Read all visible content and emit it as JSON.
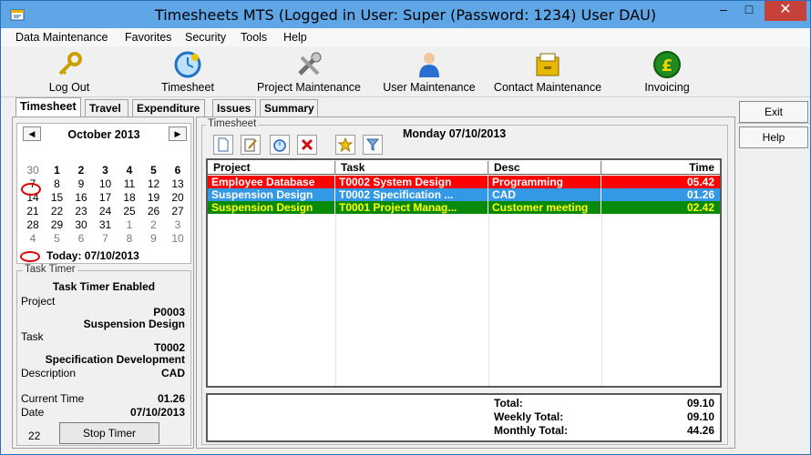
{
  "window": {
    "title": "Timesheets MTS (Logged in User: Super (Password: 1234) User DAU)"
  },
  "menu": [
    "Data Maintenance",
    "Favorites",
    "Security",
    "Tools",
    "Help"
  ],
  "toolbar": [
    {
      "label": "Log Out",
      "icon": "key-icon"
    },
    {
      "label": "Timesheet",
      "icon": "clock-icon"
    },
    {
      "label": "Project Maintenance",
      "icon": "tools-icon"
    },
    {
      "label": "User Maintenance",
      "icon": "user-icon"
    },
    {
      "label": "Contact Maintenance",
      "icon": "drawer-icon"
    },
    {
      "label": "Invoicing",
      "icon": "pound-coin-icon"
    }
  ],
  "tabs": [
    "Timesheet",
    "Travel",
    "Expenditure",
    "Issues",
    "Summary"
  ],
  "calendar": {
    "month": "October 2013",
    "weeks": [
      [
        "30",
        "1",
        "2",
        "3",
        "4",
        "5",
        "6"
      ],
      [
        "7",
        "8",
        "9",
        "10",
        "11",
        "12",
        "13"
      ],
      [
        "14",
        "15",
        "16",
        "17",
        "18",
        "19",
        "20"
      ],
      [
        "21",
        "22",
        "23",
        "24",
        "25",
        "26",
        "27"
      ],
      [
        "28",
        "29",
        "30",
        "31",
        "1",
        "2",
        "3"
      ],
      [
        "4",
        "5",
        "6",
        "7",
        "8",
        "9",
        "10"
      ]
    ],
    "today_text": "Today: 07/10/2013"
  },
  "timer": {
    "legend": "Task Timer",
    "status": "Task Timer Enabled",
    "project_label": "Project",
    "project_code": "P0003",
    "project_name": "Suspension Design",
    "task_label": "Task",
    "task_code": "T0002",
    "task_name": "Specification Development",
    "desc_label": "Description",
    "desc_value": "CAD",
    "current_time_label": "Current Time",
    "current_time_value": "01.26",
    "date_label": "Date",
    "date_value": "07/10/2013",
    "counter": "22",
    "stop_button": "Stop Timer"
  },
  "timesheet": {
    "legend": "Timesheet",
    "date": "Monday 07/10/2013",
    "columns": [
      "Project",
      "Task",
      "Desc",
      "Time"
    ],
    "rows": [
      {
        "project": "Employee Database",
        "task": "T0002 System Design",
        "desc": "Programming",
        "time": "05.42",
        "bg": "#ff0000",
        "fg": "#ffffff"
      },
      {
        "project": "Suspension Design",
        "task": "T0002 Specification ...",
        "desc": "CAD",
        "time": "01.26",
        "bg": "#3399e6",
        "fg": "#ffffff"
      },
      {
        "project": "Suspension Design",
        "task": "T0001 Project Manag...",
        "desc": "Customer meeting",
        "time": "02.42",
        "bg": "#0a8a0a",
        "fg": "#ffff00"
      }
    ],
    "totals": [
      {
        "label": "Total:",
        "value": "09.10"
      },
      {
        "label": "Weekly Total:",
        "value": "09.10"
      },
      {
        "label": "Monthly Total:",
        "value": "44.26"
      }
    ]
  },
  "side_buttons": [
    "Exit",
    "Help"
  ]
}
